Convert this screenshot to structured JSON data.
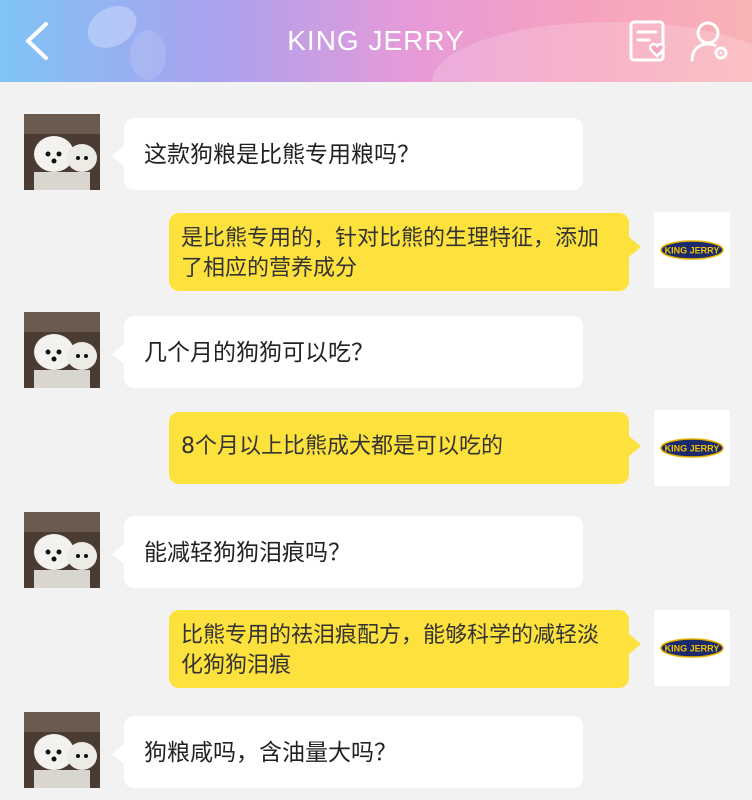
{
  "header": {
    "title": "KING JERRY",
    "back_icon": "chevron-left-icon",
    "right_icons": [
      "document-heart-icon",
      "user-settings-icon"
    ]
  },
  "brand": {
    "logo_text": "KING JERRY",
    "logo_color": "#1a2a6c",
    "logo_border": "#e8b400"
  },
  "colors": {
    "user_bubble": "#ffffff",
    "reply_bubble": "#fde13d",
    "background": "#f2f2f2"
  },
  "messages": [
    {
      "from": "user",
      "text": "这款狗粮是比熊专用粮吗？"
    },
    {
      "from": "brand",
      "text": "是比熊专用的，针对比熊的生理特征，添加了相应的营养成分"
    },
    {
      "from": "user",
      "text": "几个月的狗狗可以吃？"
    },
    {
      "from": "brand",
      "text": "8个月以上比熊成犬都是可以吃的"
    },
    {
      "from": "user",
      "text": "能减轻狗狗泪痕吗？"
    },
    {
      "from": "brand",
      "text": "比熊专用的祛泪痕配方，能够科学的减轻淡化狗狗泪痕"
    },
    {
      "from": "user",
      "text": "狗粮咸吗，含油量大吗？"
    }
  ]
}
